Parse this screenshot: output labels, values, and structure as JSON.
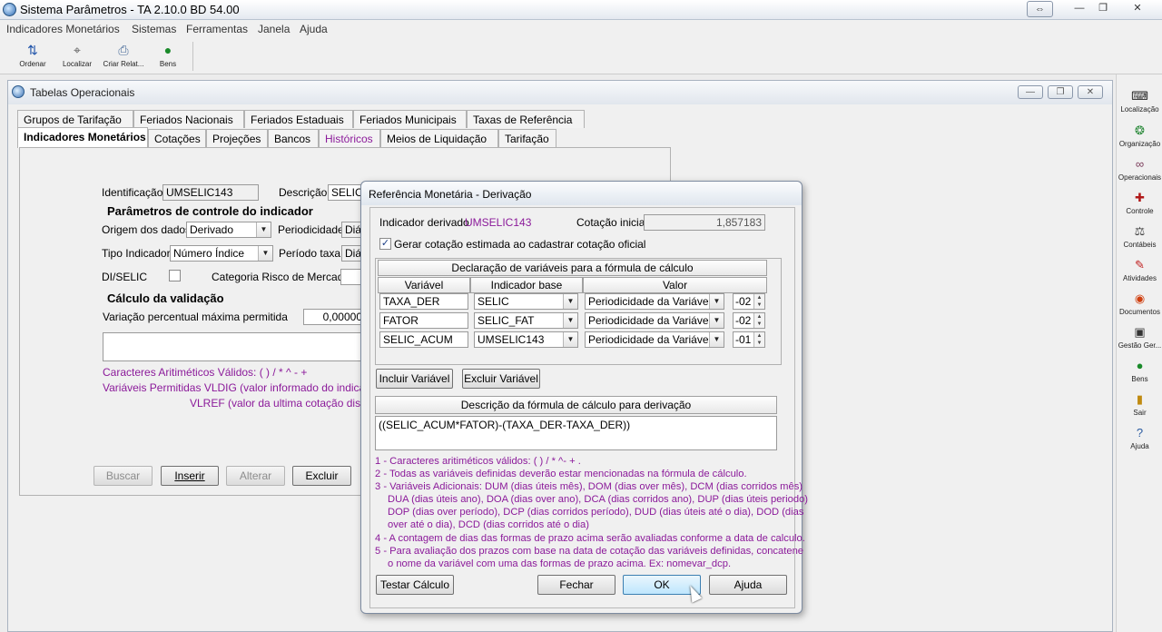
{
  "app": {
    "title": "Sistema Parâmetros -  TA 2.10.0 BD 54.00",
    "window_buttons": [
      "⇔",
      "—",
      "❐",
      "✕"
    ]
  },
  "menu": [
    "Indicadores Monetários",
    "Sistemas",
    "Ferramentas",
    "Janela",
    "Ajuda"
  ],
  "toolbar": [
    {
      "label": "Ordenar",
      "icon": "sort-az-icon"
    },
    {
      "label": "Localizar",
      "icon": "locate-icon"
    },
    {
      "label": "Criar Relat...",
      "icon": "printer-icon"
    },
    {
      "label": "Bens",
      "icon": "money-bag-icon"
    }
  ],
  "sidebar": [
    {
      "label": "Localização",
      "icon": "keyboard-icon"
    },
    {
      "label": "Organização",
      "icon": "organization-icon"
    },
    {
      "label": "Operacionais",
      "icon": "chain-icon"
    },
    {
      "label": "Controle",
      "icon": "control-icon"
    },
    {
      "label": "Contábeis",
      "icon": "scales-icon"
    },
    {
      "label": "Atividades",
      "icon": "wrench-icon"
    },
    {
      "label": "Documentos",
      "icon": "document-icon"
    },
    {
      "label": "Gestão Ger...",
      "icon": "management-icon"
    },
    {
      "label": "Bens",
      "icon": "money-bag-icon"
    },
    {
      "label": "Sair",
      "icon": "exit-door-icon"
    },
    {
      "label": "Ajuda",
      "icon": "help-icon"
    }
  ],
  "tabwin": {
    "title": "Tabelas Operacionais",
    "tabs_row1": [
      "Grupos de Tarifação",
      "Feriados Nacionais",
      "Feriados Estaduais",
      "Feriados Municipais",
      "Taxas de Referência"
    ],
    "tabs_row2": [
      "Indicadores Monetários",
      "Cotações",
      "Projeções",
      "Bancos",
      "Históricos",
      "Meios de Liquidação",
      "Tarifação"
    ],
    "ident_label": "Identificação",
    "ident_value": "UMSELIC143",
    "desc_label": "Descrição",
    "desc_value": "SELIC",
    "group_control": "Parâmetros de controle do indicador",
    "origem_label": "Origem dos dados",
    "origem_value": "Derivado",
    "period_label": "Periodicidade",
    "period_value": "Diár",
    "tipo_label": "Tipo Indicador",
    "tipo_value": "Número Índice",
    "ptaxa_label": "Período taxa",
    "ptaxa_value": "Diár",
    "diselic_label": "DI/SELIC",
    "cat_label": "Categoria Risco de Mercado",
    "group_calc": "Cálculo da validação",
    "var_label": "Variação percentual máxima permitida",
    "var_value": "0,00000",
    "car_text": "Caracteres Aritiméticos Válidos:      ( ) / * ^ - +",
    "vars_text": "Variáveis Permitidas VLDIG  (valor informado do indicador)",
    "vlref_text": "VLREF (valor da ultima cotação disponí",
    "buttons": {
      "buscar": "Buscar",
      "inserir": "Inserir",
      "alterar": "Alterar",
      "excluir": "Excluir"
    }
  },
  "dialog": {
    "title": "Referência Monetária - Derivação",
    "ind_label": "Indicador derivado",
    "ind_value": "UMSELIC143",
    "cot_label": "Cotação inicial",
    "cot_value": "1,857183",
    "check_label": "Gerar cotação estimada ao cadastrar cotação oficial",
    "grid_title": "Declaração de variáveis para a fórmula de cálculo",
    "col_var": "Variável",
    "col_ind": "Indicador base",
    "col_val": "Valor",
    "rows": [
      {
        "var": "TAXA_DER",
        "ind": "SELIC",
        "val": "Periodicidade da Variável",
        "spin": "-02"
      },
      {
        "var": "FATOR",
        "ind": "SELIC_FAT",
        "val": "Periodicidade da Variável",
        "spin": "-02"
      },
      {
        "var": "SELIC_ACUM",
        "ind": "UMSELIC143",
        "val": "Periodicidade da Variável",
        "spin": "-01"
      }
    ],
    "btn_incluir": "Incluir Variável",
    "btn_excluir": "Excluir Variável",
    "formula_title": "Descrição da fórmula de cálculo para derivação",
    "formula": "((SELIC_ACUM*FATOR)-(TAXA_DER-TAXA_DER))",
    "notes": [
      "1 - Caracteres aritiméticos válidos: ( ) / * ^- + .",
      "2 - Todas as variáveis definidas deverão estar mencionadas na fórmula de cálculo.",
      "3 - Variáveis Adicionais: DUM (dias úteis mês), DOM (dias over mês), DCM (dias corridos mês)",
      "DUA (dias úteis ano), DOA (dias over ano), DCA (dias corridos ano),  DUP (dias úteis periodo)",
      "DOP (dias over período), DCP (dias corridos período), DUD (dias úteis até o dia),  DOD (dias",
      "over até o dia), DCD (dias corridos até o dia)",
      "4 - A contagem de dias das formas de prazo acima serão avaliadas conforme a data de calculo.",
      "5 - Para avaliação dos prazos com base na data de cotação das variáveis definidas, concatene",
      "o nome da variável com uma das formas de prazo acima. Ex: nomevar_dcp."
    ],
    "btn_testar": "Testar Cálculo",
    "btn_fechar": "Fechar",
    "btn_ok": "OK",
    "btn_ajuda": "Ajuda"
  }
}
